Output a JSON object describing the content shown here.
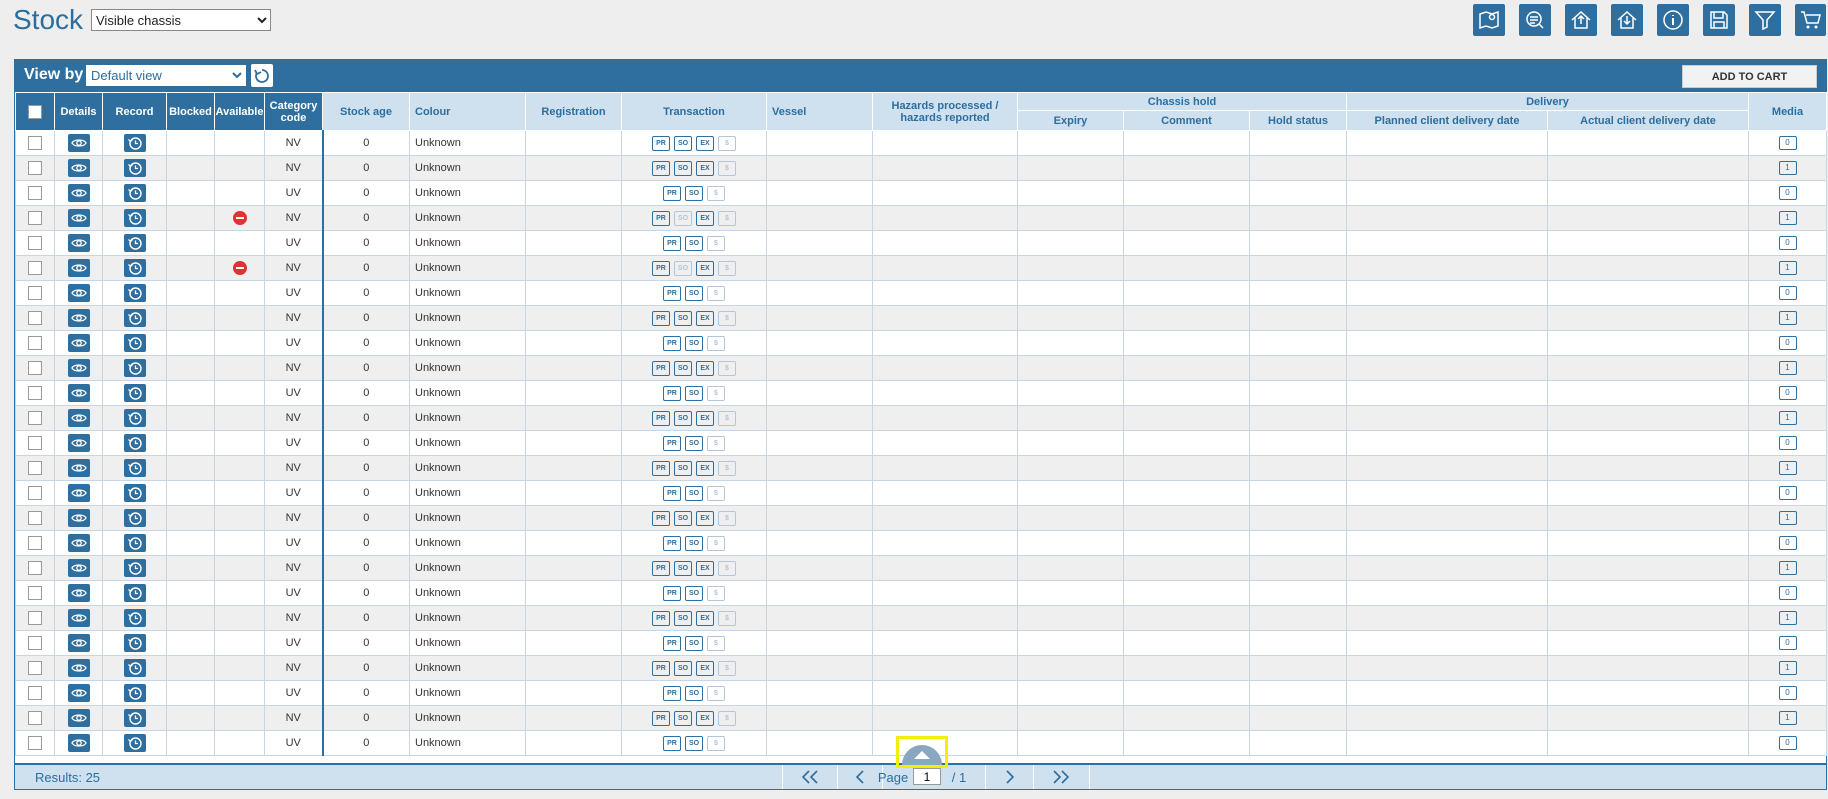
{
  "header": {
    "title": "Stock",
    "filter_selected": "Visible chassis",
    "toolbar_icons": [
      "map-pin-icon",
      "chat-search-icon",
      "upload-icon",
      "download-icon",
      "info-icon",
      "save-icon",
      "filter-icon",
      "cart-icon"
    ]
  },
  "viewbar": {
    "label": "View by",
    "view_selected": "Default view",
    "add_to_cart": "ADD TO CART"
  },
  "table": {
    "columns": {
      "details": "Details",
      "record": "Record",
      "blocked": "Blocked",
      "available": "Available",
      "category": "Category code",
      "stock_age": "Stock age",
      "colour": "Colour",
      "registration": "Registration",
      "transaction": "Transaction",
      "vessel": "Vessel",
      "hazards": "Hazards processed / hazards reported",
      "chassis_hold": "Chassis hold",
      "expiry": "Expiry",
      "comment": "Comment",
      "hold_status": "Hold status",
      "delivery": "Delivery",
      "planned_delivery": "Planned client delivery date",
      "actual_delivery": "Actual client delivery date",
      "media": "Media"
    },
    "transaction_labels": {
      "pr": "PR",
      "so": "SO",
      "ex": "EX",
      "dollar": "$"
    },
    "rows": [
      {
        "blocked": false,
        "category": "NV",
        "stock_age": "0",
        "colour": "Unknown",
        "ex": true,
        "so_active": true,
        "media": "0"
      },
      {
        "blocked": false,
        "category": "NV",
        "stock_age": "0",
        "colour": "Unknown",
        "ex": true,
        "so_active": true,
        "media": "1"
      },
      {
        "blocked": false,
        "category": "UV",
        "stock_age": "0",
        "colour": "Unknown",
        "ex": false,
        "so_active": true,
        "media": "0"
      },
      {
        "blocked": true,
        "category": "NV",
        "stock_age": "0",
        "colour": "Unknown",
        "ex": true,
        "so_active": false,
        "media": "1"
      },
      {
        "blocked": false,
        "category": "UV",
        "stock_age": "0",
        "colour": "Unknown",
        "ex": false,
        "so_active": true,
        "media": "0"
      },
      {
        "blocked": true,
        "category": "NV",
        "stock_age": "0",
        "colour": "Unknown",
        "ex": true,
        "so_active": false,
        "media": "1"
      },
      {
        "blocked": false,
        "category": "UV",
        "stock_age": "0",
        "colour": "Unknown",
        "ex": false,
        "so_active": true,
        "media": "0"
      },
      {
        "blocked": false,
        "category": "NV",
        "stock_age": "0",
        "colour": "Unknown",
        "ex": true,
        "so_active": true,
        "media": "1"
      },
      {
        "blocked": false,
        "category": "UV",
        "stock_age": "0",
        "colour": "Unknown",
        "ex": false,
        "so_active": true,
        "media": "0"
      },
      {
        "blocked": false,
        "category": "NV",
        "stock_age": "0",
        "colour": "Unknown",
        "ex": true,
        "so_active": true,
        "media": "1"
      },
      {
        "blocked": false,
        "category": "UV",
        "stock_age": "0",
        "colour": "Unknown",
        "ex": false,
        "so_active": true,
        "media": "0"
      },
      {
        "blocked": false,
        "category": "NV",
        "stock_age": "0",
        "colour": "Unknown",
        "ex": true,
        "so_active": true,
        "media": "1"
      },
      {
        "blocked": false,
        "category": "UV",
        "stock_age": "0",
        "colour": "Unknown",
        "ex": false,
        "so_active": true,
        "media": "0"
      },
      {
        "blocked": false,
        "category": "NV",
        "stock_age": "0",
        "colour": "Unknown",
        "ex": true,
        "so_active": true,
        "media": "1"
      },
      {
        "blocked": false,
        "category": "UV",
        "stock_age": "0",
        "colour": "Unknown",
        "ex": false,
        "so_active": true,
        "media": "0"
      },
      {
        "blocked": false,
        "category": "NV",
        "stock_age": "0",
        "colour": "Unknown",
        "ex": true,
        "so_active": true,
        "media": "1"
      },
      {
        "blocked": false,
        "category": "UV",
        "stock_age": "0",
        "colour": "Unknown",
        "ex": false,
        "so_active": true,
        "media": "0"
      },
      {
        "blocked": false,
        "category": "NV",
        "stock_age": "0",
        "colour": "Unknown",
        "ex": true,
        "so_active": true,
        "media": "1"
      },
      {
        "blocked": false,
        "category": "UV",
        "stock_age": "0",
        "colour": "Unknown",
        "ex": false,
        "so_active": true,
        "media": "0"
      },
      {
        "blocked": false,
        "category": "NV",
        "stock_age": "0",
        "colour": "Unknown",
        "ex": true,
        "so_active": true,
        "media": "1"
      },
      {
        "blocked": false,
        "category": "UV",
        "stock_age": "0",
        "colour": "Unknown",
        "ex": false,
        "so_active": true,
        "media": "0"
      },
      {
        "blocked": false,
        "category": "NV",
        "stock_age": "0",
        "colour": "Unknown",
        "ex": true,
        "so_active": true,
        "media": "1"
      },
      {
        "blocked": false,
        "category": "UV",
        "stock_age": "0",
        "colour": "Unknown",
        "ex": false,
        "so_active": true,
        "media": "0"
      },
      {
        "blocked": false,
        "category": "NV",
        "stock_age": "0",
        "colour": "Unknown",
        "ex": true,
        "so_active": true,
        "media": "1"
      },
      {
        "blocked": false,
        "category": "UV",
        "stock_age": "0",
        "colour": "Unknown",
        "ex": false,
        "so_active": true,
        "media": "0"
      }
    ]
  },
  "footer": {
    "results": "Results: 25",
    "page_label": "Page",
    "page_value": "1",
    "page_total": "/ 1"
  },
  "colors": {
    "brand": "#2f6f9f",
    "header_light": "#cfe0ef",
    "blocked": "#dd3333",
    "highlight": "#f2f000"
  }
}
